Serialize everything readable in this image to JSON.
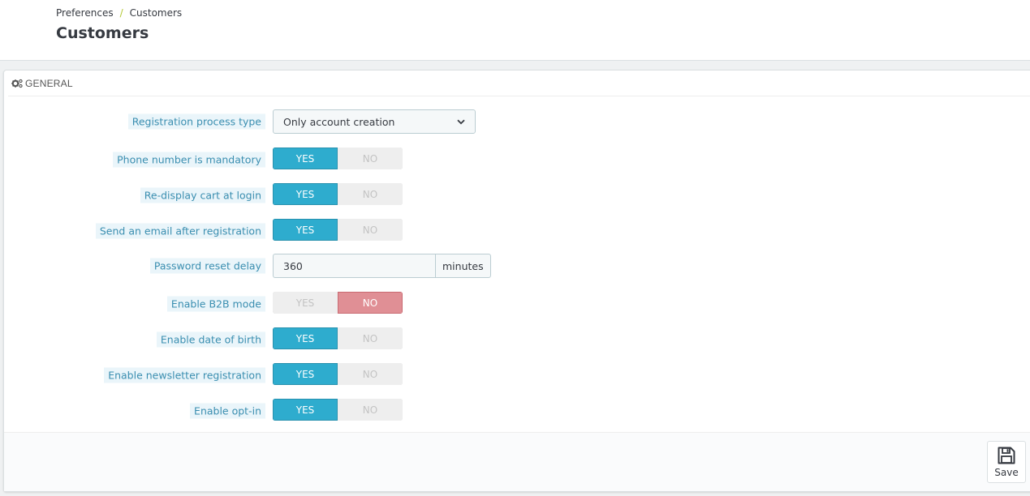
{
  "breadcrumb": {
    "parent": "Preferences",
    "separator": "/",
    "current": "Customers"
  },
  "page_title": "Customers",
  "panel": {
    "heading_icon": "cogs-icon",
    "heading": "GENERAL"
  },
  "colors": {
    "yes_active": "#2eacce",
    "no_active": "#e08f95",
    "label_text": "#3a8eb0",
    "label_bg": "#eaf5fa"
  },
  "fields": {
    "registration_process_type": {
      "label": "Registration process type",
      "selected": "Only account creation"
    },
    "phone_mandatory": {
      "label": "Phone number is mandatory",
      "yes": "YES",
      "no": "NO",
      "value": "YES"
    },
    "redisplay_cart": {
      "label": "Re-display cart at login",
      "yes": "YES",
      "no": "NO",
      "value": "YES"
    },
    "send_email": {
      "label": "Send an email after registration",
      "yes": "YES",
      "no": "NO",
      "value": "YES"
    },
    "password_reset_delay": {
      "label": "Password reset delay",
      "value": "360",
      "unit": "minutes"
    },
    "b2b_mode": {
      "label": "Enable B2B mode",
      "yes": "YES",
      "no": "NO",
      "value": "NO"
    },
    "date_of_birth": {
      "label": "Enable date of birth",
      "yes": "YES",
      "no": "NO",
      "value": "YES"
    },
    "newsletter": {
      "label": "Enable newsletter registration",
      "yes": "YES",
      "no": "NO",
      "value": "YES"
    },
    "optin": {
      "label": "Enable opt-in",
      "yes": "YES",
      "no": "NO",
      "value": "YES"
    }
  },
  "footer": {
    "save_label": "Save",
    "save_icon": "floppy-disk-icon"
  }
}
